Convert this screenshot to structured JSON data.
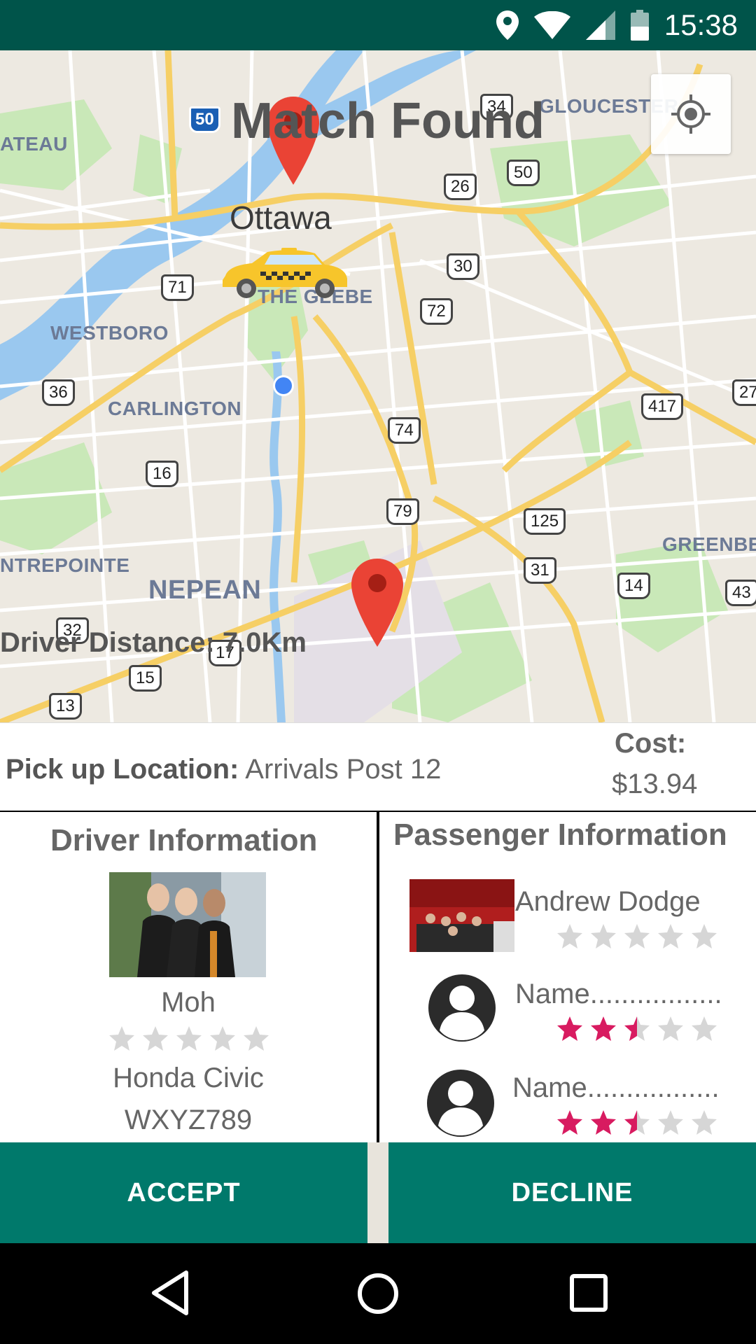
{
  "status_bar": {
    "time": "15:38"
  },
  "map": {
    "title": "Match Found",
    "city": "Ottawa",
    "labels": [
      "ATEAU",
      "GLOUCESTER",
      "THE GLEBE",
      "WESTBORO",
      "CARLINGTON",
      "NTREPOINTE",
      "NEPEAN",
      "GREENBE"
    ],
    "highways": [
      "50",
      "34",
      "26",
      "50",
      "71",
      "30",
      "72",
      "36",
      "74",
      "417",
      "27",
      "16",
      "79",
      "125",
      "31",
      "14",
      "43",
      "32",
      "17",
      "15",
      "13"
    ],
    "driver_distance_label": "Driver Distance:",
    "driver_distance_value": "7.0Km"
  },
  "pickup": {
    "label": "Pick up Location:",
    "value": "Arrivals Post 12"
  },
  "cost": {
    "label": "Cost:",
    "value": "$13.94"
  },
  "driver": {
    "section_title": "Driver Information",
    "name": "Moh",
    "rating": 0,
    "car": "Honda Civic",
    "plate": "WXYZ789"
  },
  "passengers": {
    "section_title": "Passenger Information",
    "list": [
      {
        "name": "Andrew Dodge",
        "rating": 0
      },
      {
        "name": "Name.................",
        "rating": 2.5
      },
      {
        "name": "Name.................",
        "rating": 2.5
      }
    ]
  },
  "actions": {
    "accept": "ACCEPT",
    "decline": "DECLINE"
  },
  "colors": {
    "primary": "#00796b",
    "status_bar": "#00544a",
    "star_active": "#d81b60",
    "star_inactive": "#d6d6d6",
    "marker": "#ea4335"
  },
  "icons": [
    "location-icon",
    "wifi-icon",
    "signal-icon",
    "battery-icon",
    "my-location-icon",
    "map-marker-icon",
    "taxi-icon",
    "user-avatar-icon",
    "star-icon",
    "back-icon",
    "home-icon",
    "recents-icon"
  ]
}
